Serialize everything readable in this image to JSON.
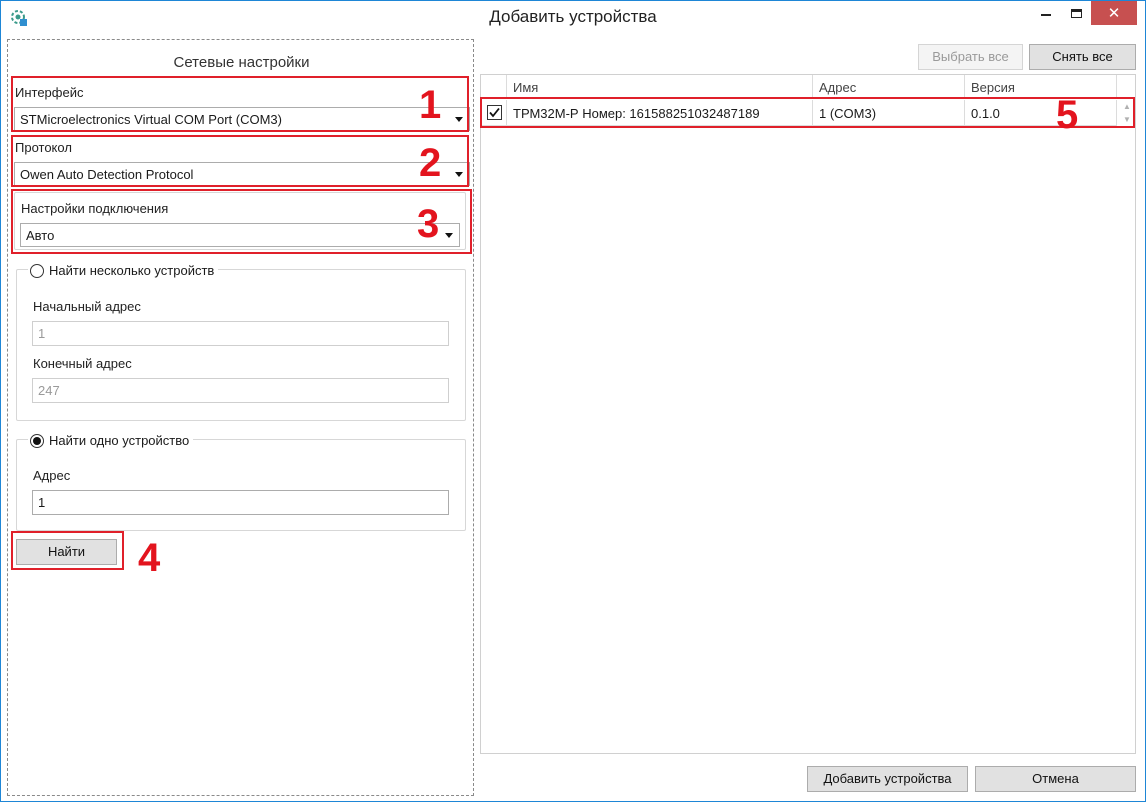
{
  "window": {
    "title": "Добавить устройства",
    "minimize_icon": "minimize-icon",
    "maximize_icon": "maximize-icon",
    "close_icon": "close-icon",
    "close_color": "#c75050"
  },
  "network": {
    "title": "Сетевые настройки",
    "interface_label": "Интерфейс",
    "interface_value": "STMicroelectronics Virtual COM Port (COM3)",
    "protocol_label": "Протокол",
    "protocol_value": "Owen Auto Detection Protocol",
    "connection_label": "Настройки подключения",
    "connection_value": "Авто"
  },
  "search_multiple": {
    "label": "Найти несколько устройств",
    "selected": false,
    "start_label": "Начальный адрес",
    "start_value": "1",
    "end_label": "Конечный адрес",
    "end_value": "247"
  },
  "search_single": {
    "label": "Найти одно устройство",
    "selected": true,
    "address_label": "Адрес",
    "address_value": "1"
  },
  "find_button": "Найти",
  "markers": [
    "1",
    "2",
    "3",
    "4",
    "5"
  ],
  "marker_color": "#e3141e",
  "toolbar": {
    "select_all": "Выбрать все",
    "deselect_all": "Снять все"
  },
  "table": {
    "columns": [
      "Имя",
      "Адрес",
      "Версия"
    ],
    "rows": [
      {
        "checked": true,
        "name": "ТРМ32М-Р Номер: 161588251032487189",
        "address": "1 (COM3)",
        "version": "0.1.0"
      }
    ]
  },
  "footer": {
    "add_button": "Добавить устройства",
    "cancel_button": "Отмена"
  }
}
